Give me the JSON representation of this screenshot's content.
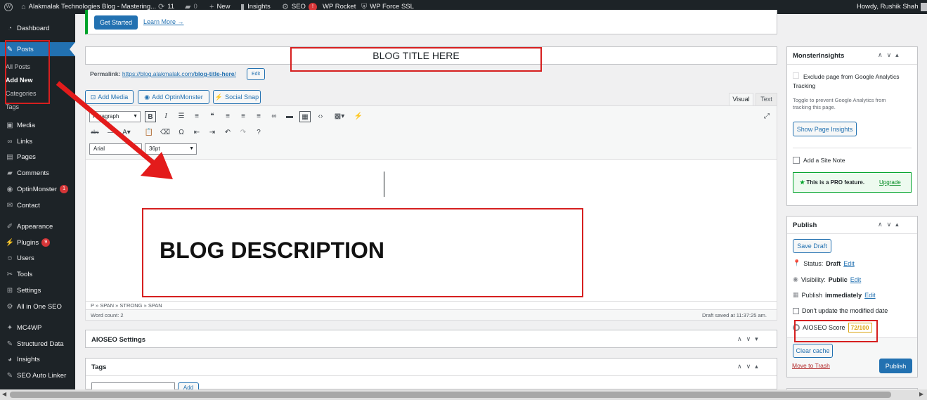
{
  "adminbar": {
    "site_title": "Alakmalak Technologies Blog - Mastering...",
    "updates_count": "11",
    "comments_count": "0",
    "new_label": "New",
    "insights_label": "Insights",
    "seo_label": "SEO",
    "seo_badge": "!",
    "wprocket_label": "WP Rocket",
    "wpforcessl_label": "WP Force SSL",
    "howdy": "Howdy, Rushik Shah"
  },
  "sidebar": {
    "items": [
      {
        "label": "Dashboard",
        "icon": "dashboard-icon"
      },
      {
        "label": "Posts",
        "icon": "pin-icon"
      },
      {
        "label": "Media",
        "icon": "media-icon"
      },
      {
        "label": "Links",
        "icon": "link-icon"
      },
      {
        "label": "Pages",
        "icon": "pages-icon"
      },
      {
        "label": "Comments",
        "icon": "comment-icon"
      },
      {
        "label": "OptinMonster",
        "icon": "optinmonster-icon",
        "count": "1"
      },
      {
        "label": "Contact",
        "icon": "mail-icon"
      },
      {
        "label": "Appearance",
        "icon": "brush-icon"
      },
      {
        "label": "Plugins",
        "icon": "plugin-icon",
        "count": "9"
      },
      {
        "label": "Users",
        "icon": "users-icon"
      },
      {
        "label": "Tools",
        "icon": "tools-icon"
      },
      {
        "label": "Settings",
        "icon": "settings-icon"
      },
      {
        "label": "All in One SEO",
        "icon": "aioseo-icon"
      },
      {
        "label": "MC4WP",
        "icon": "mc4wp-icon"
      },
      {
        "label": "Structured Data",
        "icon": "pin-icon"
      },
      {
        "label": "Insights",
        "icon": "insights-icon"
      },
      {
        "label": "SEO Auto Linker",
        "icon": "pin-icon"
      }
    ],
    "posts_sub": [
      "All Posts",
      "Add New",
      "Categories",
      "Tags"
    ]
  },
  "notice": {
    "get_started": "Get Started",
    "learn_more": "Learn More →"
  },
  "editor": {
    "title_value": "BLOG TITLE HERE",
    "permalink_label": "Permalink:",
    "permalink_base": "https://blog.alakmalak.com/",
    "permalink_slug": "blog-title-here",
    "permalink_end": "/",
    "permalink_edit": "Edit",
    "add_media": "Add Media",
    "add_optinmonster": "Add OptinMonster",
    "social_snap": "Social Snap",
    "tab_visual": "Visual",
    "tab_text": "Text",
    "format_select": "Paragraph",
    "font_select": "Arial",
    "size_select": "36pt",
    "content": "BLOG DESCRIPTION",
    "path": "P » SPAN » STRONG » SPAN",
    "word_count": "Word count: 2",
    "draft_saved": "Draft saved at 11:37:25 am."
  },
  "aioseo_settings": {
    "title": "AIOSEO Settings"
  },
  "tags_box": {
    "title": "Tags",
    "add_button": "Add"
  },
  "monsterinsights": {
    "title": "MonsterInsights",
    "exclude_label": "Exclude page from Google Analytics Tracking",
    "toggle_help": "Toggle to prevent Google Analytics from tracking this page.",
    "show_insights": "Show Page Insights",
    "site_note": "Add a Site Note",
    "pro_text": "This is a PRO feature.",
    "upgrade": "Upgrade"
  },
  "publish": {
    "title": "Publish",
    "save_draft": "Save Draft",
    "status_label": "Status:",
    "status_value": "Draft",
    "visibility_label": "Visibility:",
    "visibility_value": "Public",
    "publish_label": "Publish",
    "publish_value": "immediately",
    "edit": "Edit",
    "dont_update": "Don't update the modified date",
    "aioseo_label": "AIOSEO Score",
    "aioseo_score": "72/100",
    "clear_cache": "Clear cache",
    "move_to_trash": "Move to Trash",
    "publish_button": "Publish"
  }
}
